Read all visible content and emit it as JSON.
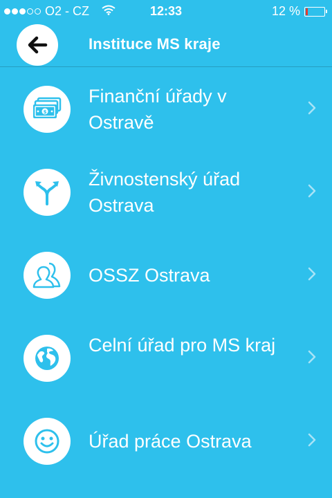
{
  "status_bar": {
    "carrier": "O2 - CZ",
    "time": "12:33",
    "battery": "12 %",
    "battery_level": 0.12
  },
  "nav": {
    "title": "Instituce MS kraje",
    "back_icon": "arrow-left-icon"
  },
  "items": [
    {
      "label": "Finanční úřady v Ostravě",
      "icon": "banknotes-icon"
    },
    {
      "label": "Živnostenský úřad Ostrava",
      "icon": "split-arrows-icon"
    },
    {
      "label": "OSSZ Ostrava",
      "icon": "people-icon"
    },
    {
      "label": "Celní úřad pro MS kraj",
      "icon": "globe-icon"
    },
    {
      "label": "Úřad práce Ostrava",
      "icon": "smiley-icon"
    }
  ],
  "colors": {
    "background": "#2ec0ec",
    "icon_circle": "#ffffff",
    "icon_glyph": "#2ec0ec",
    "chevron": "#a8e3f7",
    "battery_low": "#e23b2f"
  }
}
